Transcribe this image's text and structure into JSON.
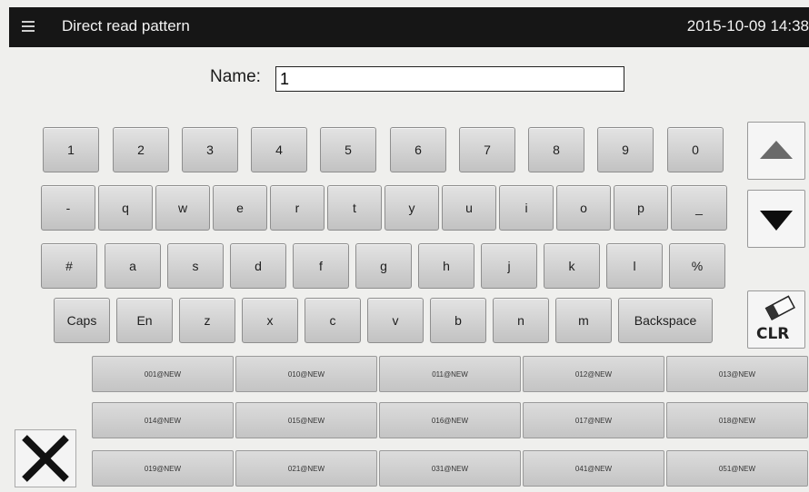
{
  "header": {
    "title": "Direct read pattern",
    "datetime": "2015-10-09 14:38"
  },
  "name_field": {
    "label": "Name:",
    "value": "1"
  },
  "keyboard": {
    "row1": [
      "1",
      "2",
      "3",
      "4",
      "5",
      "6",
      "7",
      "8",
      "9",
      "0"
    ],
    "row2": [
      "-",
      "q",
      "w",
      "e",
      "r",
      "t",
      "y",
      "u",
      "i",
      "o",
      "p",
      "_"
    ],
    "row3": [
      "#",
      "a",
      "s",
      "d",
      "f",
      "g",
      "h",
      "j",
      "k",
      "l",
      "%"
    ],
    "row4": [
      "Caps",
      "En",
      "z",
      "x",
      "c",
      "v",
      "b",
      "n",
      "m",
      "Backspace"
    ]
  },
  "side_buttons": {
    "clr_label": "CLR",
    "up_icon": "triangle-up-icon",
    "down_icon": "triangle-down-icon"
  },
  "patterns": [
    [
      "001@NEW",
      "010@NEW",
      "011@NEW",
      "012@NEW",
      "013@NEW"
    ],
    [
      "014@NEW",
      "015@NEW",
      "016@NEW",
      "017@NEW",
      "018@NEW"
    ],
    [
      "019@NEW",
      "021@NEW",
      "031@NEW",
      "041@NEW",
      "051@NEW"
    ]
  ]
}
